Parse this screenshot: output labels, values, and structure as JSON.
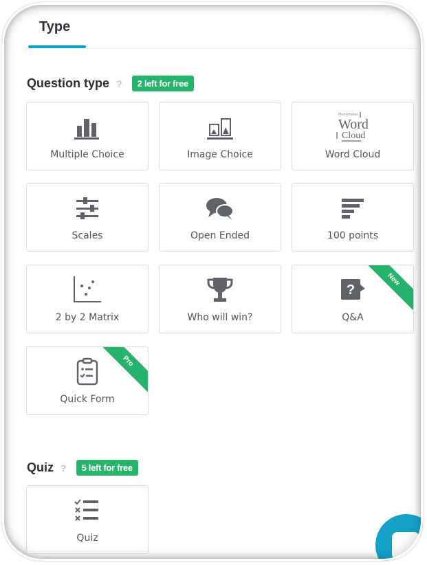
{
  "tab": {
    "label": "Type"
  },
  "question_section": {
    "title": "Question type",
    "help": "?",
    "badge": "2 left for free"
  },
  "question_types": [
    {
      "label": "Multiple Choice",
      "icon": "bar-chart-icon"
    },
    {
      "label": "Image Choice",
      "icon": "image-bars-icon"
    },
    {
      "label": "Word Cloud",
      "icon": "word-cloud-icon",
      "icon_words": [
        "Mentimeter",
        "Word",
        "Cloud"
      ]
    },
    {
      "label": "Scales",
      "icon": "sliders-icon"
    },
    {
      "label": "Open Ended",
      "icon": "speech-bubbles-icon"
    },
    {
      "label": "100 points",
      "icon": "horizontal-bars-icon"
    },
    {
      "label": "2 by 2 Matrix",
      "icon": "scatter-plot-icon"
    },
    {
      "label": "Who will win?",
      "icon": "trophy-icon"
    },
    {
      "label": "Q&A",
      "icon": "question-bubble-icon",
      "icon_text": "?",
      "ribbon": "New"
    },
    {
      "label": "Quick Form",
      "icon": "clipboard-form-icon",
      "ribbon": "Pro"
    }
  ],
  "quiz_section": {
    "title": "Quiz",
    "help": "?",
    "badge": "5 left for free"
  },
  "quiz_types": [
    {
      "label": "Quiz",
      "icon": "checklist-icon"
    }
  ],
  "colors": {
    "accent": "#0aa3c9",
    "badge_green": "#26b36b",
    "icon_gray": "#5f6268",
    "border": "#dadada"
  }
}
